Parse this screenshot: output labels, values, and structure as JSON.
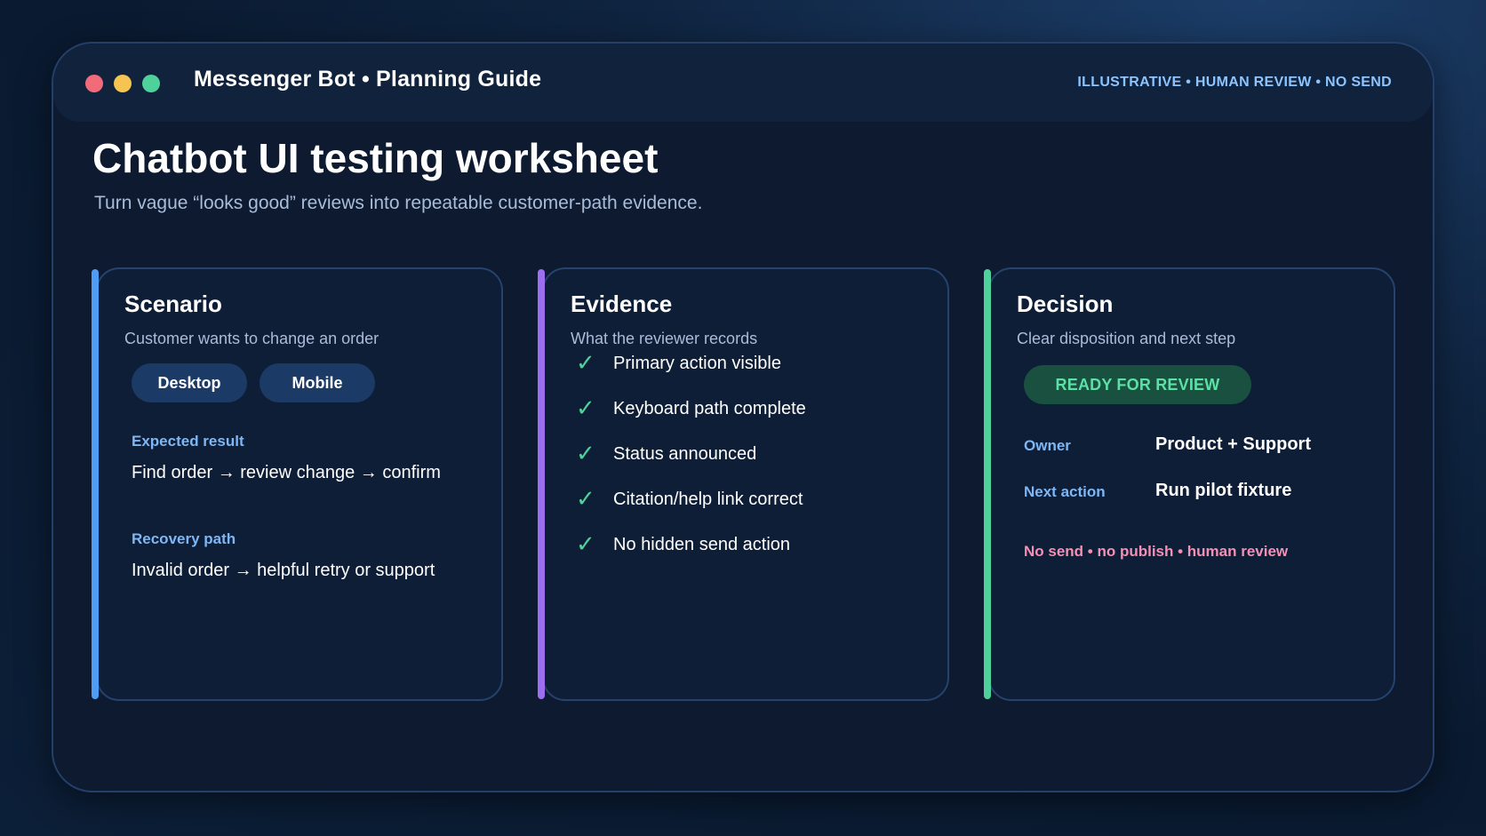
{
  "window": {
    "app_title": "Messenger Bot • Planning Guide",
    "status_flags": "ILLUSTRATIVE • HUMAN REVIEW • NO SEND"
  },
  "page": {
    "title": "Chatbot UI testing worksheet",
    "subtitle": "Turn vague “looks good” reviews into repeatable customer-path evidence."
  },
  "scenario": {
    "title": "Scenario",
    "subtitle": "Customer wants to change an order",
    "chips": [
      "Desktop",
      "Mobile"
    ],
    "expected_label": "Expected result",
    "expected_value": "Find order → review change → confirm",
    "recovery_label": "Recovery path",
    "recovery_value": "Invalid order → helpful retry or support"
  },
  "evidence": {
    "title": "Evidence",
    "subtitle": "What the reviewer records",
    "items": [
      "Primary action visible",
      "Keyboard path complete",
      "Status announced",
      "Citation/help link correct",
      "No hidden send action"
    ]
  },
  "decision": {
    "title": "Decision",
    "subtitle": "Clear disposition and next step",
    "badge": "READY FOR REVIEW",
    "owner_label": "Owner",
    "owner_value": "Product + Support",
    "next_label": "Next action",
    "next_value": "Run pilot fixture",
    "guardrail": "No send • no publish • human review"
  },
  "colors": {
    "accent_scenario": "#4f9cf5",
    "accent_evidence": "#9b6ff0",
    "accent_decision": "#4fd19b",
    "label_blue": "#7db7f5",
    "guardrail_pink": "#f58fb4"
  },
  "icons": {
    "check": "✓"
  }
}
